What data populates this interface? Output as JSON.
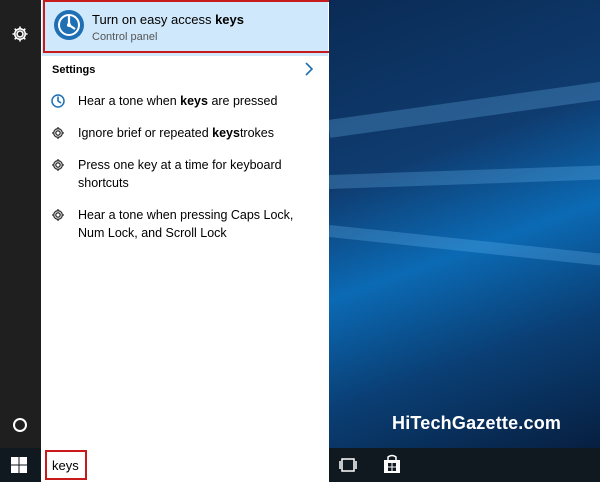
{
  "best_match": {
    "title_prefix": "Turn on easy access ",
    "title_bold": "keys",
    "subtitle": "Control panel"
  },
  "settings": {
    "header": "Settings",
    "items": [
      {
        "pre": "Hear a tone when ",
        "bold": "keys",
        "post": " are pressed",
        "icon": "accessibility-icon"
      },
      {
        "pre": "Ignore brief or repeated ",
        "bold": "keys",
        "post": "trokes",
        "icon": "gear-icon"
      },
      {
        "pre": "Press one key at a time for keyboard shortcuts",
        "bold": "",
        "post": "",
        "icon": "gear-icon"
      },
      {
        "pre": "Hear a tone when pressing Caps Lock, Num Lock, and Scroll Lock",
        "bold": "",
        "post": "",
        "icon": "gear-icon"
      }
    ]
  },
  "search": {
    "value": "keys"
  },
  "watermark": "HiTechGazette.com",
  "colors": {
    "accent_bg": "#cfe8fb",
    "highlight_border": "#c81a1a",
    "taskbar": "#101820"
  }
}
